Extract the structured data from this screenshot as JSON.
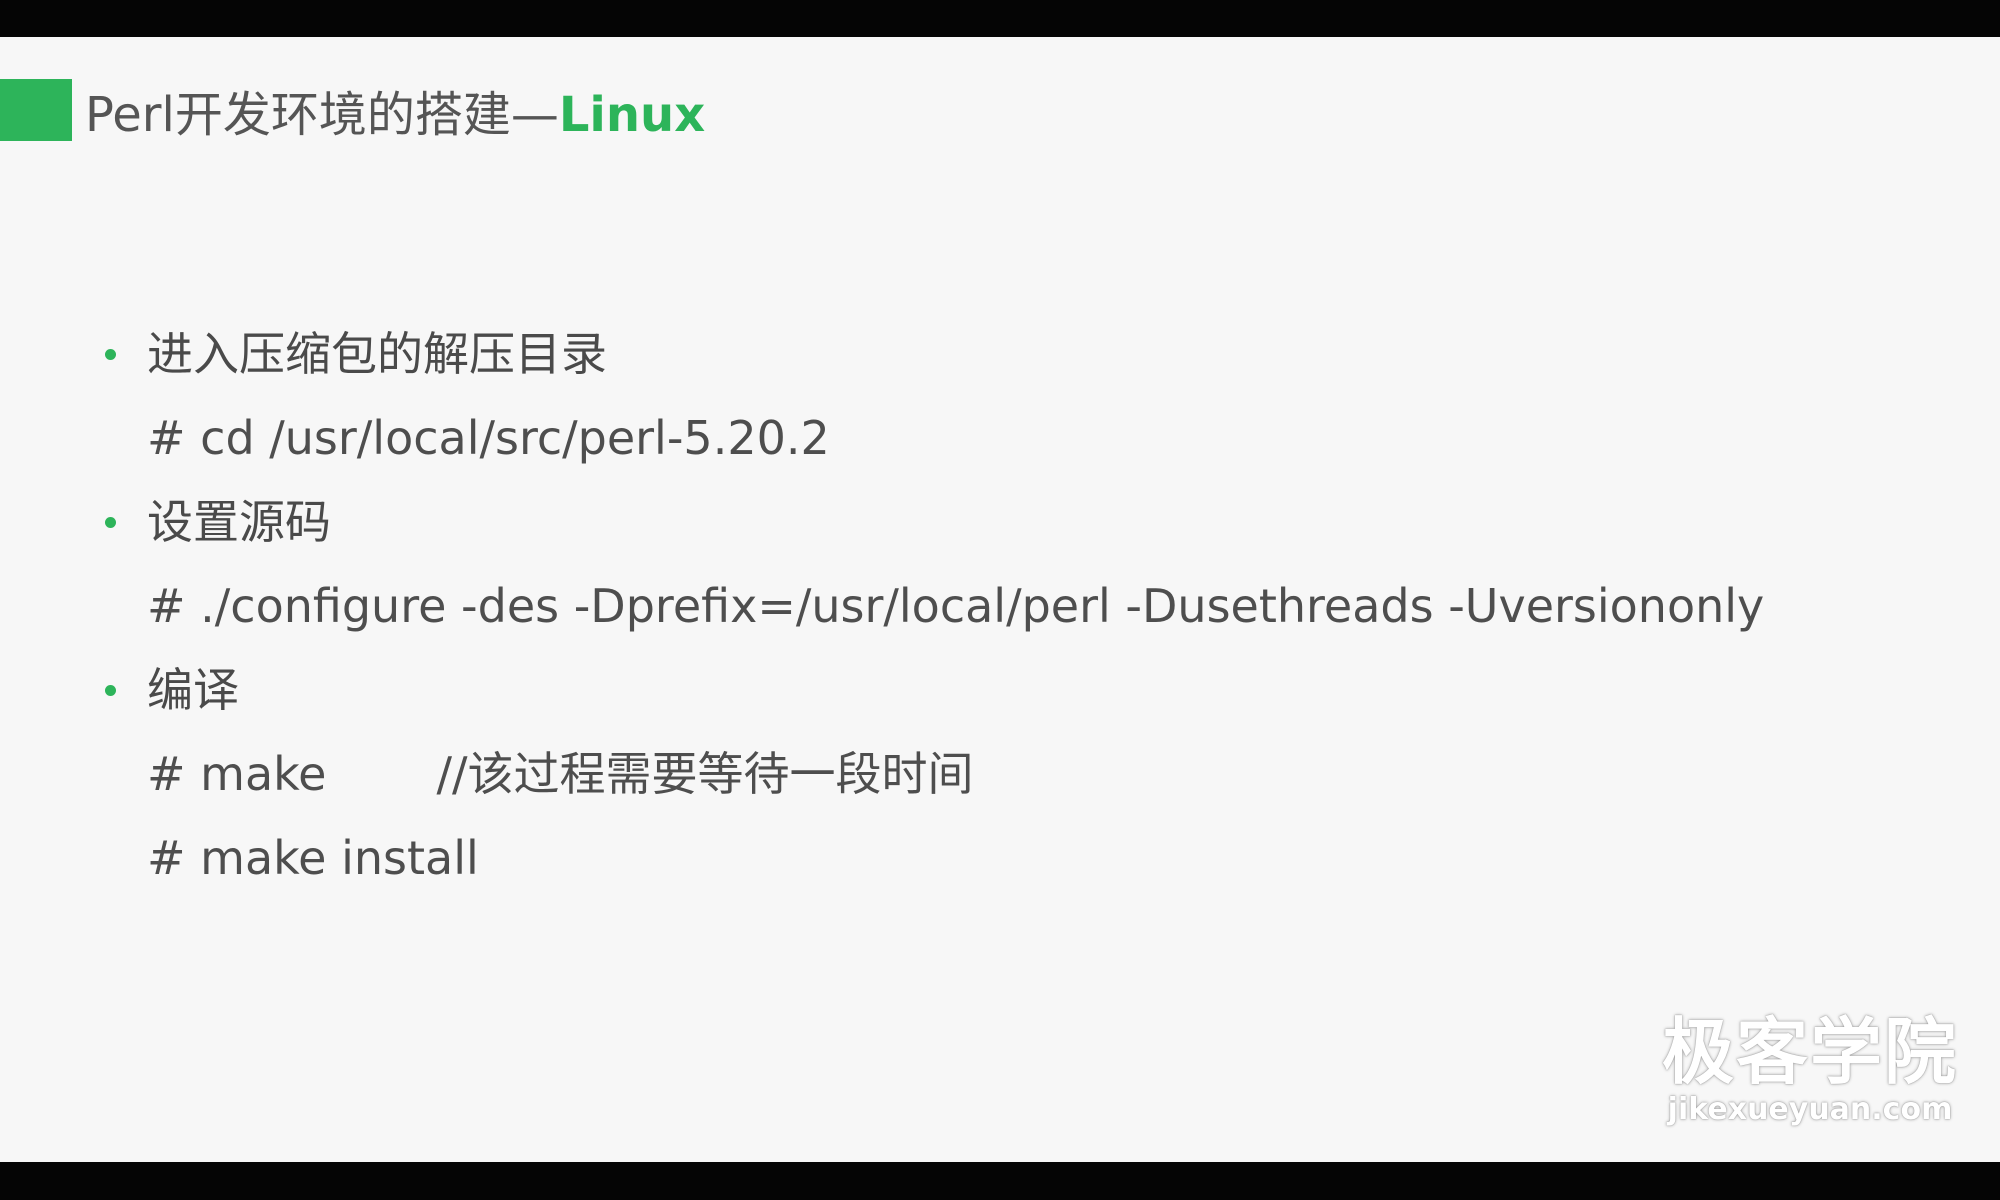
{
  "slide": {
    "title_prefix": "Perl开发环境的搭建—",
    "title_accent": "Linux",
    "accent_color": "#2db45a"
  },
  "steps": [
    {
      "label": "进入压缩包的解压目录",
      "commands": [
        {
          "text": "# cd /usr/local/src/perl-5.20.2",
          "comment": ""
        }
      ]
    },
    {
      "label": "设置源码",
      "commands": [
        {
          "text": "# ./configure -des -Dprefix=/usr/local/perl -Dusethreads -Uversiononly",
          "comment": ""
        }
      ]
    },
    {
      "label": "编译",
      "commands": [
        {
          "text": "# make",
          "comment": "//该过程需要等待一段时间"
        },
        {
          "text": "# make install",
          "comment": ""
        }
      ]
    }
  ],
  "watermark": {
    "brand_cn": "极客学院",
    "brand_url": "jikexueyuan.com"
  }
}
